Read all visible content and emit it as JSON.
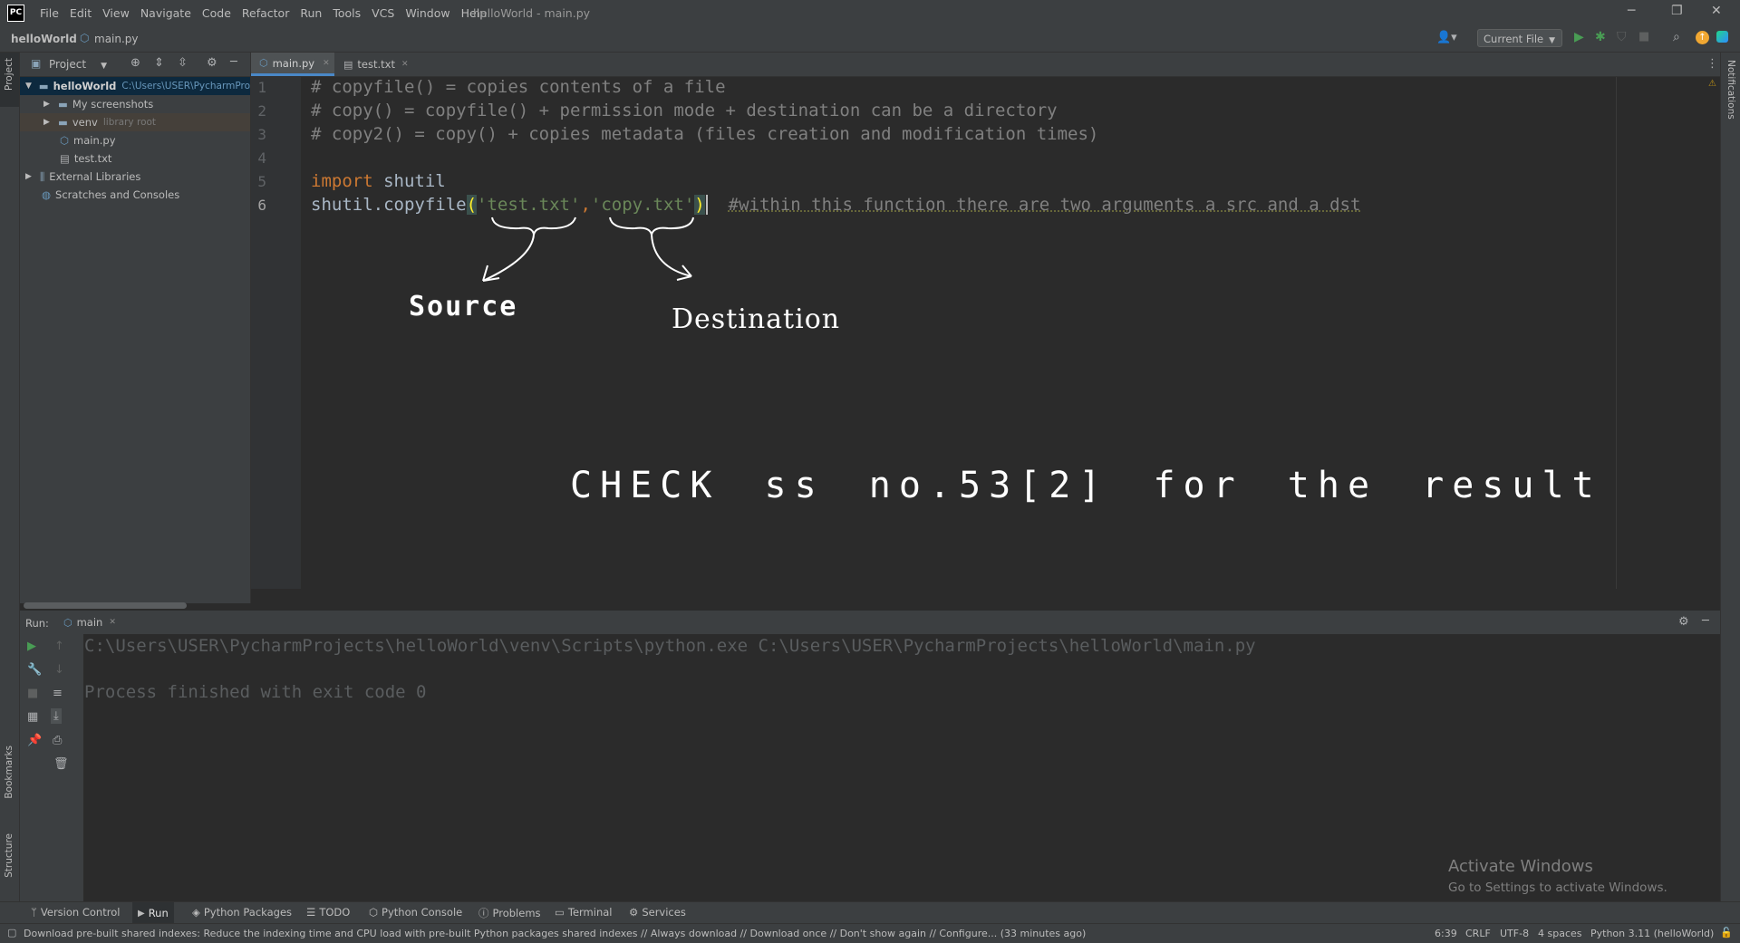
{
  "app": {
    "logo": "PC",
    "window_title": "helloWorld - main.py"
  },
  "menu": [
    "File",
    "Edit",
    "View",
    "Navigate",
    "Code",
    "Refactor",
    "Run",
    "Tools",
    "VCS",
    "Window",
    "Help"
  ],
  "breadcrumb": {
    "project": "helloWorld",
    "file": "main.py"
  },
  "run_config": {
    "label": "Current File"
  },
  "project_panel": {
    "title": "Project",
    "tree": [
      {
        "label": "helloWorld",
        "hint": "C:\\Users\\USER\\PycharmPro",
        "depth": 0
      },
      {
        "label": "My screenshots",
        "hint": "",
        "depth": 1
      },
      {
        "label": "venv",
        "hint": "library root",
        "depth": 1
      },
      {
        "label": "main.py",
        "hint": "",
        "depth": 2
      },
      {
        "label": "test.txt",
        "hint": "",
        "depth": 2
      },
      {
        "label": "External Libraries",
        "hint": "",
        "depth": 0
      },
      {
        "label": "Scratches and Consoles",
        "hint": "",
        "depth": 0
      }
    ]
  },
  "editor_tabs": [
    {
      "label": "main.py",
      "active": true
    },
    {
      "label": "test.txt",
      "active": false
    }
  ],
  "code": {
    "line_numbers": [
      "1",
      "2",
      "3",
      "4",
      "5",
      "6"
    ],
    "line1": "# copyfile() = copies contents of a file",
    "line2": "# copy() = copyfile() + permission mode + destination can be a directory",
    "line3": "# copy2() = copy() + copies metadata (files creation and modification times)",
    "line5_kw": "import",
    "line5_rest": " shutil",
    "line6_call": "shutil.copyfile",
    "line6_open": "(",
    "line6_arg1": "'test.txt'",
    "line6_comma": ",",
    "line6_arg2": "'copy.txt'",
    "line6_close": ")",
    "line6_comment": "#within this function there are two arguments a src and a dst"
  },
  "annotations": {
    "source": "Source",
    "destination": "Destination",
    "note": "CHECK ss no.53[2] for the result"
  },
  "run_panel": {
    "label": "Run:",
    "tab": "main",
    "output_line1": "C:\\Users\\USER\\PycharmProjects\\helloWorld\\venv\\Scripts\\python.exe C:\\Users\\USER\\PycharmProjects\\helloWorld\\main.py",
    "output_line2": "Process finished with exit code 0"
  },
  "watermark": {
    "title": "Activate Windows",
    "subtitle": "Go to Settings to activate Windows."
  },
  "side_labels": {
    "project": "Project",
    "bookmarks": "Bookmarks",
    "structure": "Structure",
    "notifications": "Notifications"
  },
  "bottom_tabs": [
    "Version Control",
    "Run",
    "Python Packages",
    "TODO",
    "Python Console",
    "Problems",
    "Terminal",
    "Services"
  ],
  "status": {
    "message": "Download pre-built shared indexes: Reduce the indexing time and CPU load with pre-built Python packages shared indexes // Always download // Download once // Don't show again // Configure... (33 minutes ago)",
    "position": "6:39",
    "line_sep": "CRLF",
    "encoding": "UTF-8",
    "indent": "4 spaces",
    "interpreter": "Python 3.11 (helloWorld)"
  },
  "colors": {
    "keyword": "#cc7832",
    "string": "#6a8759",
    "comment": "#808080",
    "text": "#a9b7c6"
  }
}
